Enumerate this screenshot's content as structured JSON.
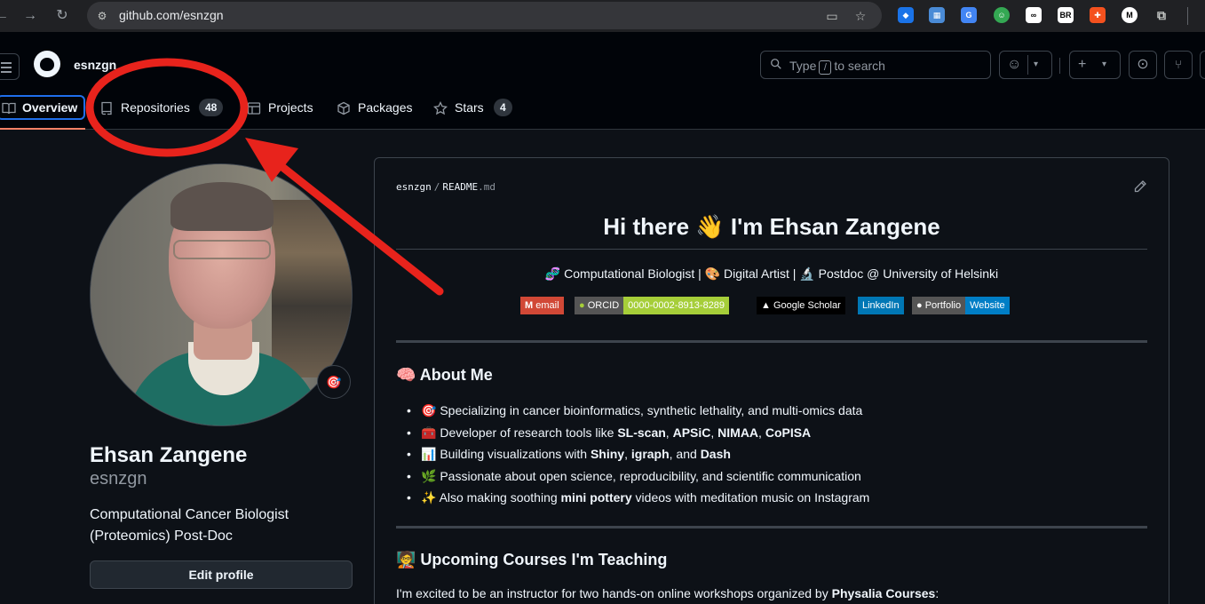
{
  "browser": {
    "url": "github.com/esnzgn",
    "extensions": [
      "shield-ext",
      "image-ext",
      "translate-ext",
      "android-ext",
      "glasses-ext",
      "br-ext",
      "grid-ext",
      "m-ext",
      "puzzle-ext"
    ],
    "ext_labels": {
      "br": "BR",
      "m": "M"
    }
  },
  "header": {
    "username": "esnzgn",
    "search_placeholder_pre": "Type",
    "search_key": "/",
    "search_placeholder_post": "to search"
  },
  "tabs": [
    {
      "label": "Overview",
      "active": true
    },
    {
      "label": "Repositories",
      "count": "48"
    },
    {
      "label": "Projects"
    },
    {
      "label": "Packages"
    },
    {
      "label": "Stars",
      "count": "4"
    }
  ],
  "profile": {
    "name": "Ehsan Zangene",
    "login": "esnzgn",
    "bio": "Computational Cancer Biologist (Proteomics) Post-Doc",
    "status_emoji": "🎯",
    "edit_label": "Edit profile"
  },
  "readme": {
    "owner": "esnzgn",
    "file": "README",
    "ext": ".md",
    "title": "Hi there 👋 I'm Ehsan Zangene",
    "subtitle": "🧬 Computational Biologist | 🎨 Digital Artist | 🔬 Postdoc @ University of Helsinki",
    "shields": [
      {
        "left": "email",
        "left_color": "#d14836",
        "icon": "M"
      },
      {
        "left": "ORCID",
        "right": "0000-0002-8913-8289",
        "left_color": "#555555",
        "right_color": "#a6ce39",
        "icon": "iD"
      },
      {
        "left": "Google Scholar",
        "left_color": "#000000",
        "icon": "🎓"
      },
      {
        "left": "LinkedIn",
        "left_color": "#0077b5"
      },
      {
        "left": "Portfolio",
        "right": "Website",
        "left_color": "#555555",
        "right_color": "#007ec6",
        "icon": "gh"
      }
    ],
    "about_heading": "🧠 About Me",
    "about_items": [
      {
        "emoji": "🎯",
        "parts": [
          "Specializing in cancer bioinformatics, synthetic lethality, and multi-omics data"
        ]
      },
      {
        "emoji": "🧰",
        "parts": [
          "Developer of research tools like ",
          "SL-scan",
          ", ",
          "APSiC",
          ", ",
          "NIMAA",
          ", ",
          "CoPISA"
        ]
      },
      {
        "emoji": "📊",
        "parts": [
          "Building visualizations with ",
          "Shiny",
          ", ",
          "igraph",
          ", and ",
          "Dash"
        ]
      },
      {
        "emoji": "🌿",
        "parts": [
          "Passionate about open science, reproducibility, and scientific communication"
        ]
      },
      {
        "emoji": "✨",
        "parts": [
          "Also making soothing ",
          "mini pottery",
          " videos with meditation music on Instagram"
        ]
      }
    ],
    "courses_heading": "🧑‍🏫 Upcoming Courses I'm Teaching",
    "courses_intro": "I'm excited to be an instructor for two hands-on online workshops organized by ",
    "courses_org": "Physalia Courses",
    "courses_end": ":"
  },
  "colors": {
    "annotation": "#e8231c",
    "accent_underline": "#f78166",
    "focus": "#1f6feb"
  }
}
